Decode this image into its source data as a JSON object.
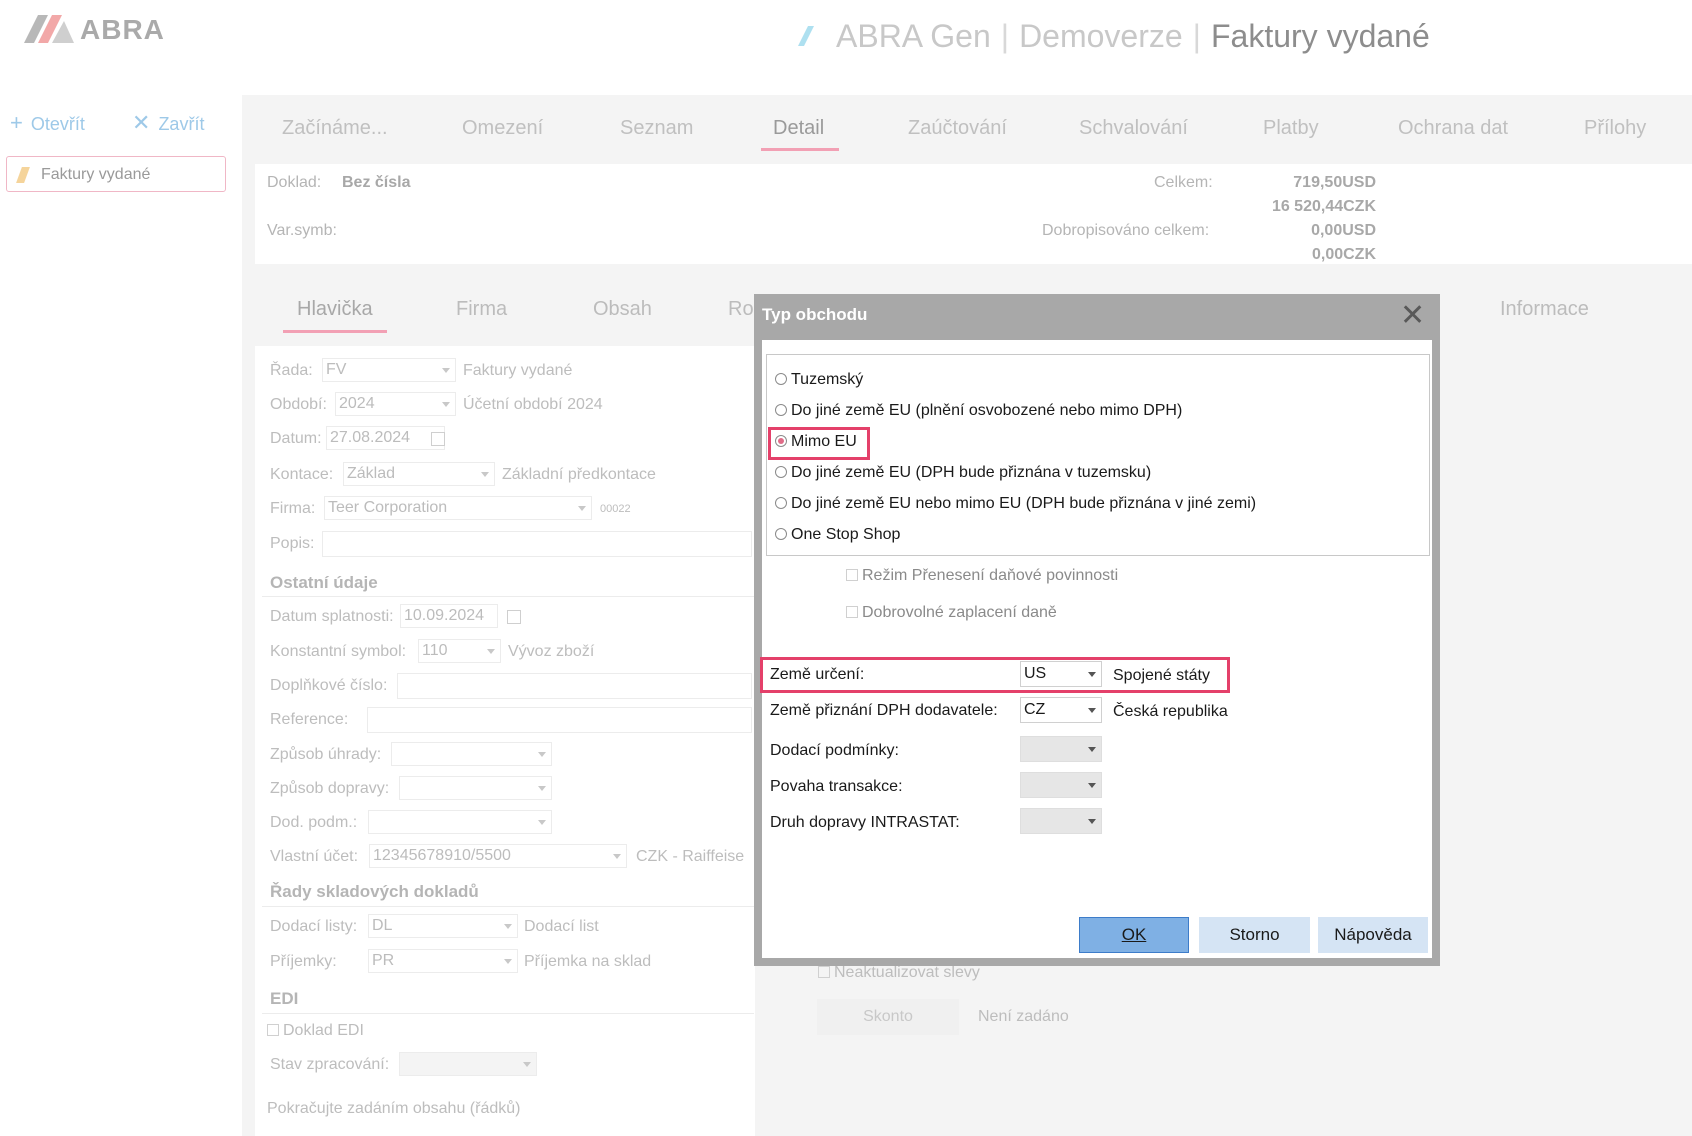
{
  "app": {
    "logo_text": "ABRA",
    "title_product": "ABRA Gen",
    "title_company": "Demoverze",
    "title_agenda": "Faktury vydané"
  },
  "left_panel": {
    "open_label": "Otevřít",
    "close_label": "Zavřít",
    "open_item": "Faktury vydané"
  },
  "main_tabs": [
    "Začínáme...",
    "Omezení",
    "Seznam",
    "Detail",
    "Zaúčtování",
    "Schvalování",
    "Platby",
    "Ochrana dat",
    "Přílohy"
  ],
  "active_main_tab": "Detail",
  "doc_info": {
    "doklad_label": "Doklad:",
    "doklad_value": "Bez čísla",
    "varsymb_label": "Var.symb:",
    "total_label": "Celkem:",
    "total_usd": "719,50USD",
    "total_czk": "16 520,44CZK",
    "credit_label": "Dobropisováno celkem:",
    "credit_usd": "0,00USD",
    "credit_czk": "0,00CZK"
  },
  "sub_tabs": [
    "Hlavička",
    "Firma",
    "Obsah",
    "Ro",
    "Informace"
  ],
  "form": {
    "rada_label": "Řada:",
    "rada_value": "FV",
    "rada_desc": "Faktury vydané",
    "obdobi_label": "Období:",
    "obdobi_value": "2024",
    "obdobi_desc": "Účetní období 2024",
    "datum_label": "Datum:",
    "datum_value": "27.08.2024",
    "kontace_label": "Kontace:",
    "kontace_value": "Základ",
    "kontace_desc": "Základní předkontace",
    "firma_label": "Firma:",
    "firma_value": "Teer Corporation",
    "firma_code": "00022",
    "popis_label": "Popis:",
    "section_other": "Ostatní údaje",
    "splatnost_label": "Datum splatnosti:",
    "splatnost_value": "10.09.2024",
    "konst_label": "Konstantní symbol:",
    "konst_value": "110",
    "konst_desc": "Vývoz zboží",
    "doplnkove_label": "Doplňkové číslo:",
    "reference_label": "Reference:",
    "uhrada_label": "Způsob úhrady:",
    "doprava_label": "Způsob dopravy:",
    "dodpodm_label": "Dod. podm.:",
    "ucet_label": "Vlastní účet:",
    "ucet_value": "12345678910/5500",
    "ucet_desc": "CZK - Raiffeise",
    "section_stock": "Řady skladových dokladů",
    "dodaci_label": "Dodací listy:",
    "dodaci_value": "DL",
    "dodaci_desc": "Dodací list",
    "prijemky_label": "Příjemky:",
    "prijemky_value": "PR",
    "prijemky_desc": "Příjemka na sklad",
    "section_edi": "EDI",
    "edi_check": "Doklad EDI",
    "stav_label": "Stav zpracování:",
    "continue_hint": "Pokračujte zadáním obsahu (řádků)",
    "neaktualizovat": "Neaktualizovat slevy",
    "skonto_button": "Skonto",
    "skonto_status": "Není zadáno"
  },
  "dialog": {
    "title": "Typ obchodu",
    "options": [
      "Tuzemský",
      "Do jiné země EU (plnění osvobozené nebo mimo DPH)",
      "Mimo EU",
      "Do jiné země EU (DPH bude přiznána v tuzemsku)",
      "Do jiné země EU nebo mimo EU (DPH bude přiznána v jiné zemi)",
      "One Stop Shop"
    ],
    "selected_option": "Mimo EU",
    "check_reverse_charge": "Režim Přenesení daňové povinnosti",
    "check_voluntary": "Dobrovolné zaplacení daně",
    "country_dest_label": "Země určení:",
    "country_dest_code": "US",
    "country_dest_name": "Spojené státy",
    "country_vat_label": "Země přiznání DPH dodavatele:",
    "country_vat_code": "CZ",
    "country_vat_name": "Česká republika",
    "delivery_terms_label": "Dodací podmínky:",
    "transaction_label": "Povaha transakce:",
    "intrastat_label": "Druh dopravy INTRASTAT:",
    "ok_label": "OK",
    "storno_label": "Storno",
    "help_label": "Nápověda",
    "highlight_color": "#e4406a"
  }
}
